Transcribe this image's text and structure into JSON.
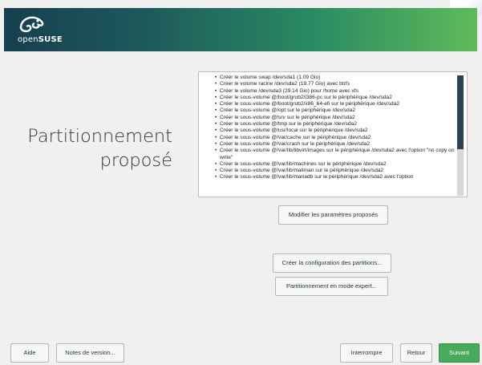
{
  "header": {
    "brand_prefix": "open",
    "brand_name": "SUSE"
  },
  "page_title": {
    "line1": "Partitionnement",
    "line2": "proposé"
  },
  "proposal_items": [
    "Créer le volume swap /dev/sda1 (1.09 Gio)",
    "Créer le volume racine /dev/sda2 (19.77 Gio) avec btrfs",
    "Créer le volume /dev/sda3 (29.14 Gio) pour /home avec xfs",
    "Créer le sous-volume @/boot/grub2/i386-pc sur le périphérique /dev/sda2",
    "Créer le sous-volume @/boot/grub2/x86_64-efi sur le périphérique /dev/sda2",
    "Créer le sous-volume @/opt sur le périphérique /dev/sda2",
    "Créer le sous-volume @/srv sur le périphérique /dev/sda2",
    "Créer le sous-volume @/tmp sur le périphérique /dev/sda2",
    "Créer le sous-volume @/usr/local sur le périphérique /dev/sda2",
    "Créer le sous-volume @/var/cache sur le périphérique /dev/sda2",
    "Créer le sous-volume @/var/crash sur le périphérique /dev/sda2",
    "Créer le sous-volume @/var/lib/libvirt/images sur le périphérique /dev/sda2 avec l'option \"no copy on write\"",
    "Créer le sous-volume @/var/lib/machines sur le périphérique /dev/sda2",
    "Créer le sous-volume @/var/lib/mailman sur le périphérique /dev/sda2",
    "Créer le sous-volume @/var/lib/mariadb sur le périphérique /dev/sda2 avec l'option"
  ],
  "buttons": {
    "modify": "Modifier les paramètres proposés",
    "create_config": "Créer la configuration des partitions...",
    "expert": "Partitionnement en mode expert...",
    "help": "Aide",
    "release_notes": "Notes de version...",
    "abort": "Interrompre",
    "back": "Retour",
    "next": "Suivant"
  },
  "colors": {
    "accent": "#4aa95a",
    "header_dark": "#173f4f",
    "header_light": "#5fbb5a"
  }
}
